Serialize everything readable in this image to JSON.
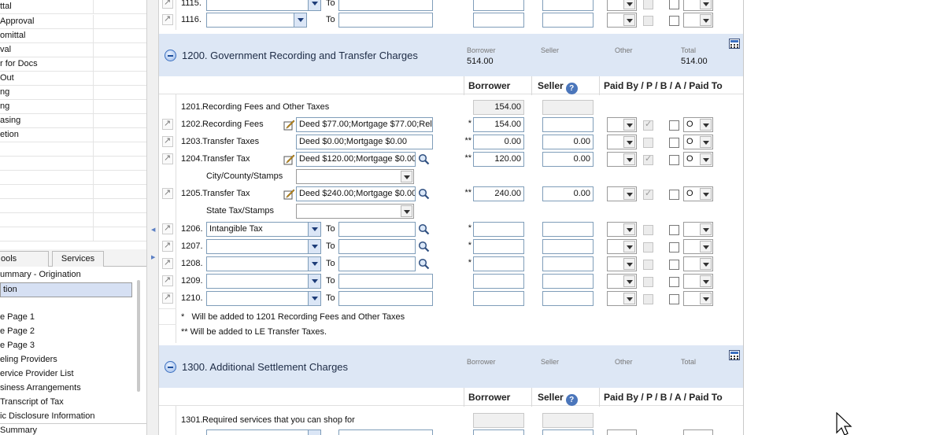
{
  "sidebar": {
    "top_items": [
      "ttal",
      " Approval",
      "omittal",
      "val",
      "r for Docs",
      "Out",
      "ng",
      "ng",
      "asing",
      "etion"
    ],
    "tabs": [
      "ools",
      "Services"
    ],
    "nav_items": [
      "ummary - Origination",
      "tion",
      "",
      "e Page 1",
      "e Page 2",
      "e Page 3",
      "eling Providers",
      "ervice Provider List",
      "siness Arrangements",
      "Transcript of Tax",
      "ic Disclosure Information",
      "Summary"
    ]
  },
  "labels": {
    "borrower": "Borrower",
    "seller": "Seller",
    "other": "Other",
    "total": "Total",
    "paid_by": "Paid By  / P / B / A / Paid To",
    "to": "To",
    "help": "?"
  },
  "section_1100": {
    "rows": [
      {
        "num": "1115.",
        "to": "To"
      },
      {
        "num": "1116.",
        "to": "To"
      }
    ]
  },
  "section_1200": {
    "title": "1200. Government Recording and Transfer Charges",
    "borrower_total": "514.00",
    "total": "514.00",
    "row_1201": {
      "num": "1201.",
      "label": "Recording Fees and Other Taxes",
      "borrower": "154.00"
    },
    "row_1202": {
      "num": "1202.",
      "label": "Recording Fees",
      "desc": "Deed $77.00;Mortgage $77.00;Rele",
      "mark": "*",
      "borrower": "154.00",
      "paid_to": "O"
    },
    "row_1203": {
      "num": "1203.",
      "label": "Transfer Taxes",
      "desc": "Deed $0.00;Mortgage $0.00",
      "mark": "**",
      "borrower": "0.00",
      "seller": "0.00",
      "paid_to": "O"
    },
    "row_1204": {
      "num": "1204.",
      "label": "Transfer Tax",
      "desc": "Deed $120.00;Mortgage $0.00",
      "mark": "**",
      "borrower": "120.00",
      "seller": "0.00",
      "paid_to": "O",
      "sub_label": "City/County/Stamps"
    },
    "row_1205": {
      "num": "1205.",
      "label": "Transfer Tax",
      "desc": "Deed $240.00;Mortgage $0.00",
      "mark": "**",
      "borrower": "240.00",
      "seller": "0.00",
      "paid_to": "O",
      "sub_label": "State Tax/Stamps"
    },
    "row_1206": {
      "num": "1206.",
      "name": "Intangible Tax",
      "mark": "*"
    },
    "row_1207": {
      "num": "1207.",
      "mark": "*"
    },
    "row_1208": {
      "num": "1208.",
      "mark": "*"
    },
    "row_1209": {
      "num": "1209."
    },
    "row_1210": {
      "num": "1210."
    },
    "note1_mark": "*",
    "note1": "Will be added to 1201 Recording Fees and Other Taxes",
    "note2": "** Will be added to LE Transfer Taxes."
  },
  "section_1300": {
    "title": "1300. Additional Settlement Charges",
    "row_1301": {
      "num": "1301.",
      "label": "Required services that you can shop for"
    }
  }
}
